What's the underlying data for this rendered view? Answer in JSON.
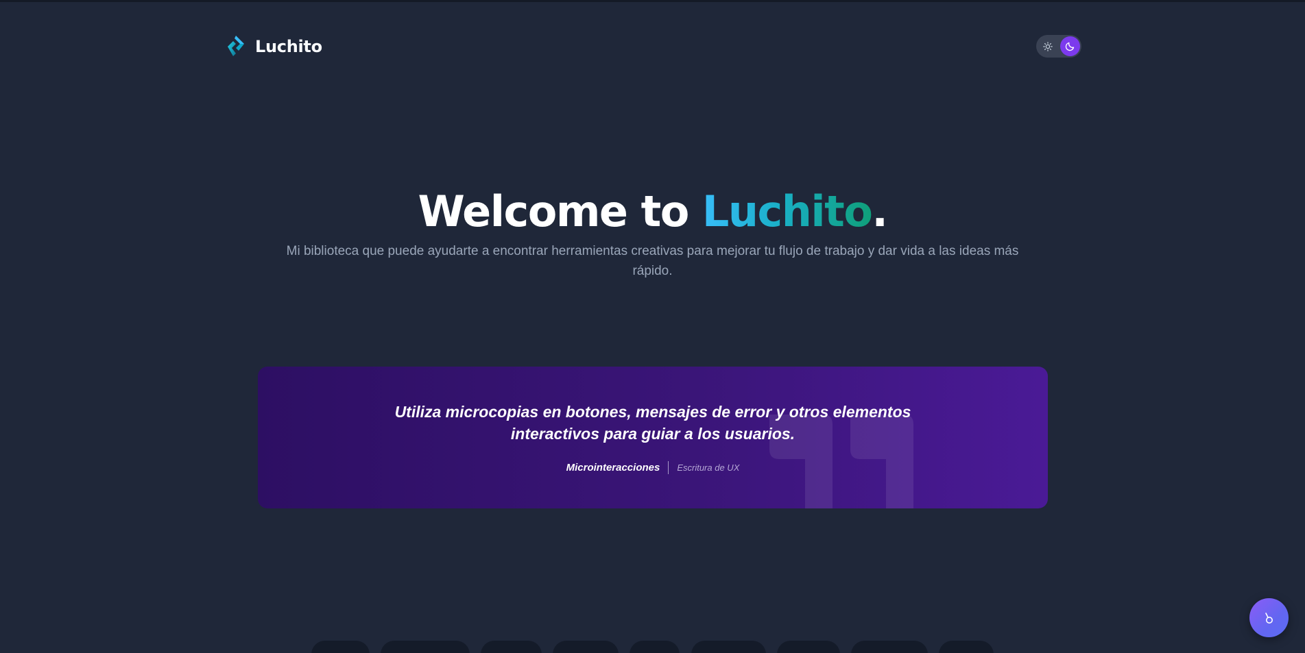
{
  "header": {
    "logo_text": "Luchito",
    "logo_icon": "diamond-chevrons-logo",
    "theme_toggle": {
      "light_icon": "sun-icon",
      "dark_icon": "moon-icon",
      "active": "dark"
    }
  },
  "hero": {
    "title_prefix": "Welcome to ",
    "title_brand": "Luchito",
    "title_suffix": ".",
    "subtitle": "Mi biblioteca que puede ayudarte a encontrar herramientas creativas para mejorar tu flujo de trabajo y dar vida a las ideas más rápido."
  },
  "quote": {
    "text": "Utiliza microcopias en botones, mensajes de error y otros elementos interactivos para guiar a los usuarios.",
    "category": "Microinteracciones",
    "subcategory": "Escritura de UX",
    "decoration_icon": "quote-marks-icon"
  },
  "fab": {
    "icon": "pointer-hand-icon"
  },
  "category_pills": {
    "count_visible": 9
  },
  "colors": {
    "background": "#1f2739",
    "brand_gradient_start": "#38bdf8",
    "brand_gradient_end": "#0f9f7a",
    "quote_card_start": "#2d0f63",
    "quote_card_end": "#4a1a96",
    "toggle_active": "#7c3aed",
    "fab": "#7c5cf6"
  }
}
